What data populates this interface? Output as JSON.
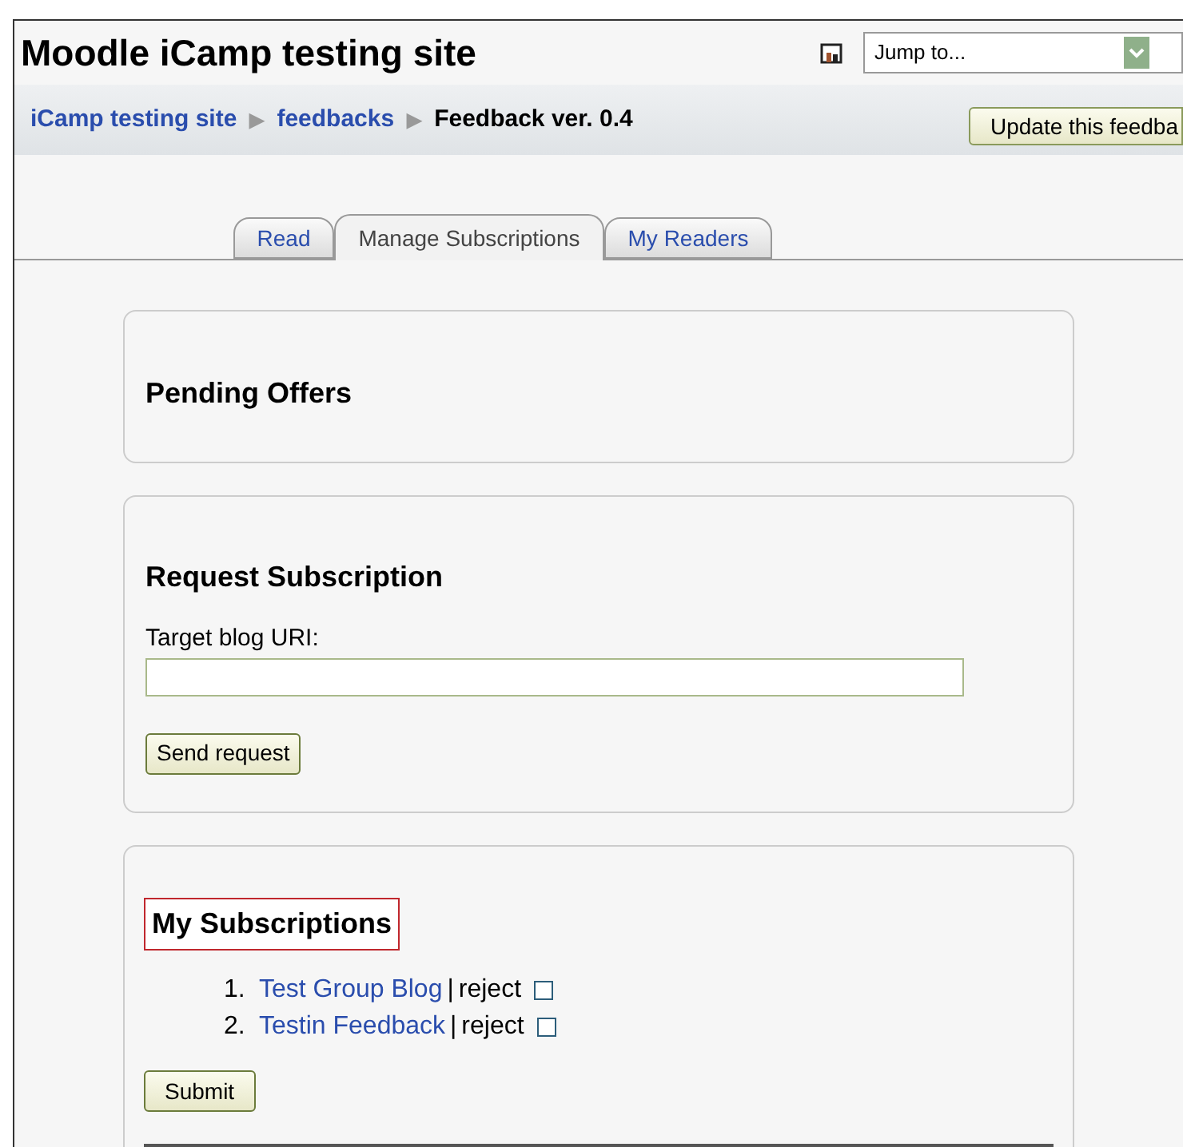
{
  "header": {
    "title": "Moodle iCamp testing site",
    "jump_select": {
      "value": "Jump to..."
    }
  },
  "breadcrumb": {
    "items": [
      {
        "label": "iCamp testing site",
        "link": true
      },
      {
        "label": "feedbacks",
        "link": true
      },
      {
        "label": "Feedback ver. 0.4",
        "link": false
      }
    ],
    "separator": "▶",
    "button": "Update this feedba"
  },
  "tabs": [
    {
      "label": "Read",
      "selected": false
    },
    {
      "label": "Manage Subscriptions",
      "selected": true
    },
    {
      "label": "My Readers",
      "selected": false
    }
  ],
  "pending": {
    "heading": "Pending Offers"
  },
  "request": {
    "heading": "Request Subscription",
    "field_label": "Target blog URI:",
    "button": "Send request"
  },
  "subscriptions": {
    "heading": "My Subscriptions",
    "highlighted": true,
    "items": [
      {
        "number": "1.",
        "title": "Test Group Blog",
        "separator": "|",
        "action": "reject",
        "checked": false
      },
      {
        "number": "2.",
        "title": "Testin Feedback",
        "separator": "|",
        "action": "reject",
        "checked": false
      }
    ],
    "button": "Submit"
  }
}
